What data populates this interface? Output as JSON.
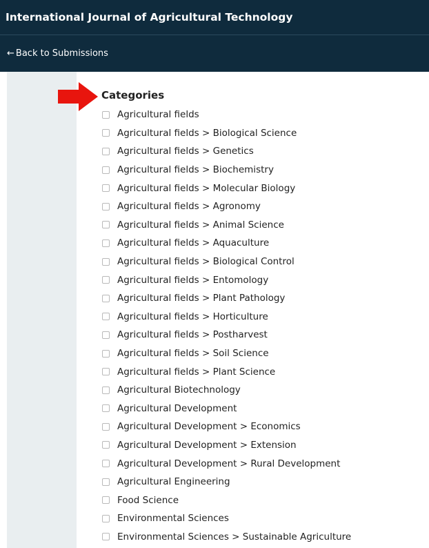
{
  "header": {
    "journal_title": "International Journal of Agricultural Technology",
    "back_label": "Back to Submissions",
    "back_arrow": "←"
  },
  "categories": {
    "heading": "Categories",
    "items": [
      {
        "label": "Agricultural fields",
        "checked": false
      },
      {
        "label": "Agricultural fields > Biological Science",
        "checked": false
      },
      {
        "label": "Agricultural fields > Genetics",
        "checked": false
      },
      {
        "label": "Agricultural fields > Biochemistry",
        "checked": false
      },
      {
        "label": "Agricultural fields > Molecular Biology",
        "checked": false
      },
      {
        "label": "Agricultural fields > Agronomy",
        "checked": false
      },
      {
        "label": "Agricultural fields > Animal Science",
        "checked": false
      },
      {
        "label": "Agricultural fields > Aquaculture",
        "checked": false
      },
      {
        "label": "Agricultural fields > Biological Control",
        "checked": false
      },
      {
        "label": "Agricultural fields > Entomology",
        "checked": false
      },
      {
        "label": "Agricultural fields > Plant Pathology",
        "checked": false
      },
      {
        "label": "Agricultural fields > Horticulture",
        "checked": false
      },
      {
        "label": "Agricultural fields > Postharvest",
        "checked": false
      },
      {
        "label": "Agricultural fields > Soil Science",
        "checked": false
      },
      {
        "label": "Agricultural fields > Plant Science",
        "checked": false
      },
      {
        "label": "Agricultural Biotechnology",
        "checked": false
      },
      {
        "label": "Agricultural Development",
        "checked": false
      },
      {
        "label": "Agricultural Development > Economics",
        "checked": false
      },
      {
        "label": "Agricultural Development > Extension",
        "checked": false
      },
      {
        "label": "Agricultural Development > Rural Development",
        "checked": false
      },
      {
        "label": "Agricultural Engineering",
        "checked": false
      },
      {
        "label": "Food Science",
        "checked": false
      },
      {
        "label": "Environmental Sciences",
        "checked": false
      },
      {
        "label": "Environmental Sciences > Sustainable Agriculture",
        "checked": false
      }
    ]
  },
  "colors": {
    "header_bg": "#0f2b3d",
    "side_panel_bg": "#e9eef0",
    "annotation_arrow": "#e8150e"
  },
  "icons": {
    "annotation": "red-arrow-icon",
    "back": "left-arrow-icon"
  }
}
